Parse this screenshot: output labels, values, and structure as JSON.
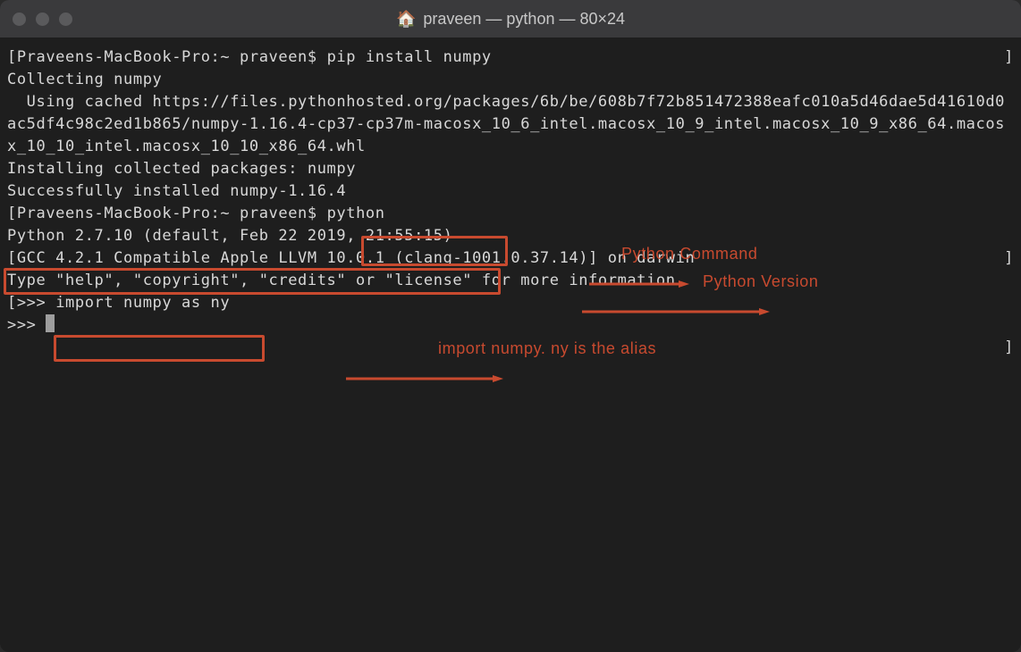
{
  "titlebar": {
    "title": "praveen — python — 80×24",
    "home_icon": "🏠"
  },
  "terminal": {
    "line1_open": "[",
    "line1_prompt": "Praveens-MacBook-Pro:~ praveen$ ",
    "line1_cmd": "pip install numpy",
    "line1_close": "]",
    "line2": "Collecting numpy",
    "line3": "  Using cached https://files.pythonhosted.org/packages/6b/be/608b7f72b851472388eafc010a5d46dae5d41610d0ac5df4c98c2ed1b865/numpy-1.16.4-cp37-cp37m-macosx_10_6_intel.macosx_10_9_intel.macosx_10_9_x86_64.macosx_10_10_intel.macosx_10_10_x86_64.whl",
    "line4": "Installing collected packages: numpy",
    "line5": "Successfully installed numpy-1.16.4",
    "line6_open": "[",
    "line6_prompt": "Praveens-MacBook-Pro:~ praveen$ ",
    "line6_cmd": "python",
    "line6_close": "]",
    "line7": "Python 2.7.10 (default, Feb 22 2019, 21:55:15)",
    "line8": "[GCC 4.2.1 Compatible Apple LLVM 10.0.1 (clang-1001.0.37.14)] on darwin",
    "line9": "Type \"help\", \"copyright\", \"credits\" or \"license\" for more information.",
    "line10_open": "[",
    "line10_prompt": ">>> ",
    "line10_cmd": "import numpy as ny",
    "line10_close": "]",
    "line11_prompt": ">>> "
  },
  "annotations": {
    "python_cmd_label": "Python Command",
    "python_version_label": "Python Version",
    "import_label": "import numpy. ny is the alias"
  },
  "colors": {
    "annotation": "#c84a2f",
    "terminal_bg": "#1e1e1e",
    "terminal_fg": "#d8d8d8",
    "titlebar_bg": "#3a3a3c"
  }
}
